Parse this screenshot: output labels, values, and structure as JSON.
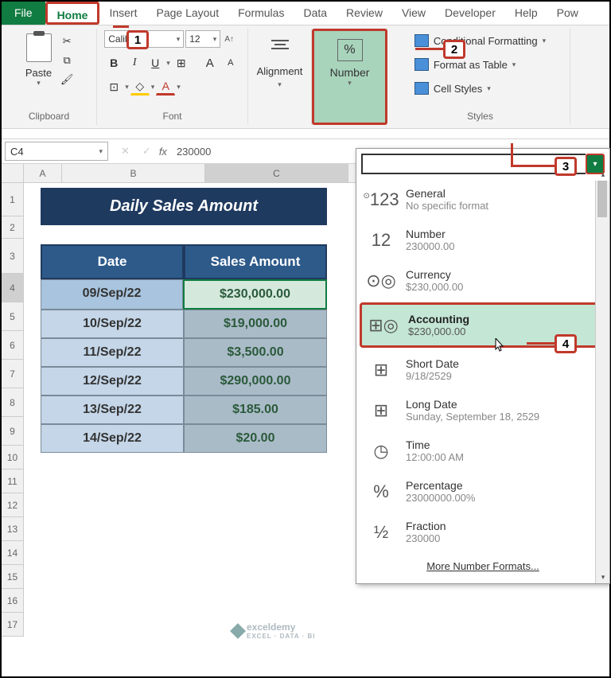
{
  "tabs": [
    "File",
    "Home",
    "Insert",
    "Page Layout",
    "Formulas",
    "Data",
    "Review",
    "View",
    "Developer",
    "Help",
    "Pow"
  ],
  "ribbon": {
    "clipboard": {
      "paste": "Paste",
      "label": "Clipboard"
    },
    "font": {
      "name": "Calibri",
      "size": "12",
      "label": "Font"
    },
    "alignment": {
      "label": "Alignment"
    },
    "number": {
      "label": "Number"
    },
    "styles": {
      "conditional": "Conditional Formatting",
      "table": "Format as Table",
      "cell": "Cell Styles",
      "label": "Styles"
    }
  },
  "formula_bar": {
    "cell": "C4",
    "value": "230000"
  },
  "callouts": {
    "c1": "1",
    "c2": "2",
    "c3": "3",
    "c4": "4"
  },
  "table": {
    "title": "Daily Sales Amount",
    "headers": [
      "Date",
      "Sales Amount"
    ],
    "rows": [
      {
        "date": "09/Sep/22",
        "amount": "$230,000.00"
      },
      {
        "date": "10/Sep/22",
        "amount": "$19,000.00"
      },
      {
        "date": "11/Sep/22",
        "amount": "$3,500.00"
      },
      {
        "date": "12/Sep/22",
        "amount": "$290,000.00"
      },
      {
        "date": "13/Sep/22",
        "amount": "$185.00"
      },
      {
        "date": "14/Sep/22",
        "amount": "$20.00"
      }
    ]
  },
  "columns": [
    "A",
    "B",
    "C"
  ],
  "rows": [
    "1",
    "2",
    "3",
    "4",
    "5",
    "6",
    "7",
    "8",
    "9",
    "10",
    "11",
    "12",
    "13",
    "14",
    "15",
    "16",
    "17"
  ],
  "dropdown": {
    "items": [
      {
        "icon": "123",
        "title": "General",
        "sub": "No specific format"
      },
      {
        "icon": "12",
        "title": "Number",
        "sub": "230000.00"
      },
      {
        "icon": "cur",
        "title": "Currency",
        "sub": "$230,000.00"
      },
      {
        "icon": "acc",
        "title": "Accounting",
        "sub": "$230,000.00"
      },
      {
        "icon": "sd",
        "title": "Short Date",
        "sub": "9/18/2529"
      },
      {
        "icon": "ld",
        "title": "Long Date",
        "sub": "Sunday, September 18, 2529"
      },
      {
        "icon": "tm",
        "title": "Time",
        "sub": "12:00:00 AM"
      },
      {
        "icon": "pc",
        "title": "Percentage",
        "sub": "23000000.00%"
      },
      {
        "icon": "fr",
        "title": "Fraction",
        "sub": "230000"
      }
    ],
    "more": "More Number Formats..."
  },
  "watermark": {
    "name": "exceldemy",
    "sub": "EXCEL · DATA · BI"
  }
}
